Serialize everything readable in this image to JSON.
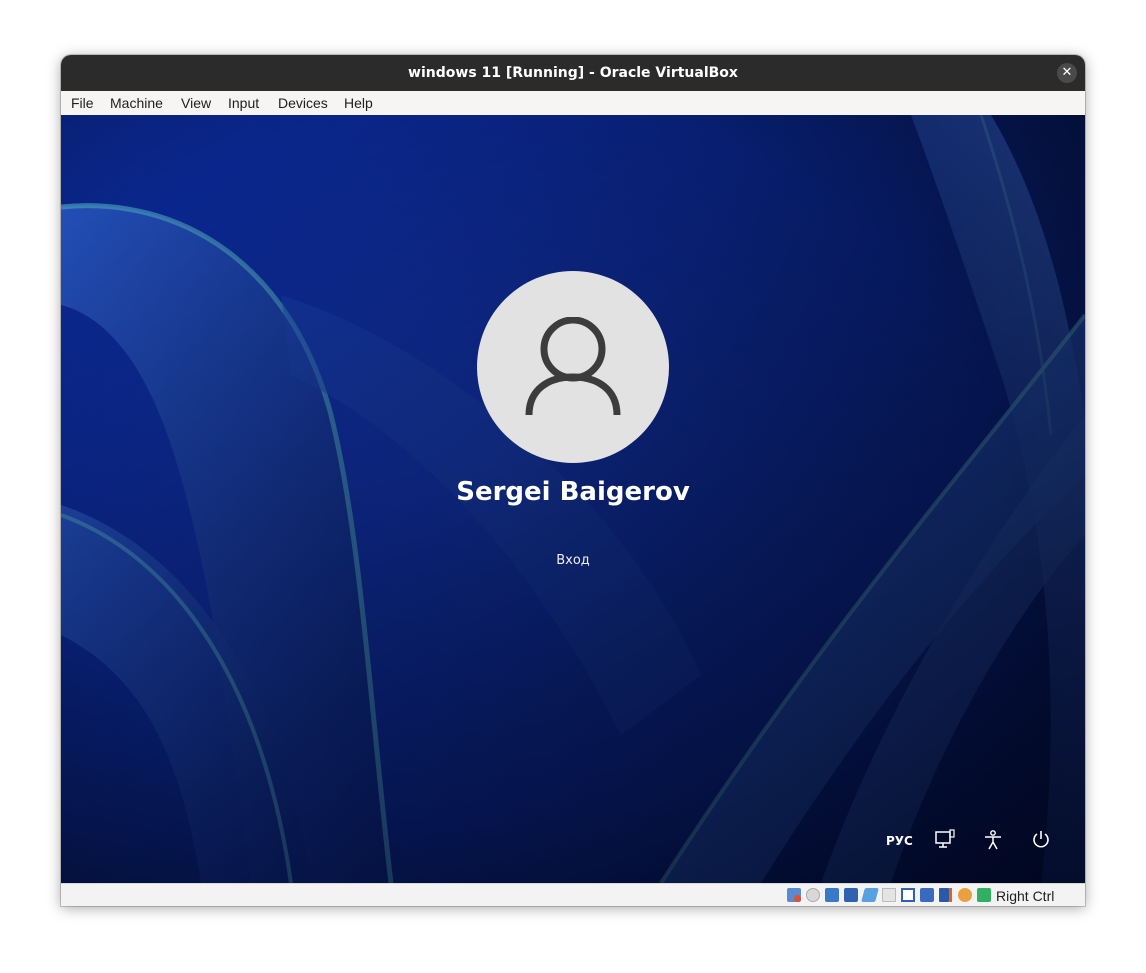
{
  "window": {
    "title": "windows 11 [Running] - Oracle VirtualBox",
    "close_label": "✕"
  },
  "menubar": {
    "items": [
      "File",
      "Machine",
      "View",
      "Input",
      "Devices",
      "Help"
    ]
  },
  "lockscreen": {
    "user_name": "Sergei Baigerov",
    "sign_in_label": "Вход",
    "language": "РУС",
    "tray_icons": [
      "network-icon",
      "accessibility-icon",
      "power-icon"
    ]
  },
  "statusbar": {
    "icons": [
      "hard-disk-icon",
      "optical-drive-icon",
      "audio-icon",
      "network-adapter-icon",
      "usb-icon",
      "shared-folders-icon",
      "display-icon",
      "recording-icon",
      "cpu-icon",
      "mouse-integration-icon",
      "keyboard-icon"
    ],
    "host_key": "Right Ctrl"
  },
  "colors": {
    "titlebar": "#2b2b2b",
    "wallpaper_base": "#0a2a9e",
    "avatar_bg": "#e2e2e2"
  }
}
